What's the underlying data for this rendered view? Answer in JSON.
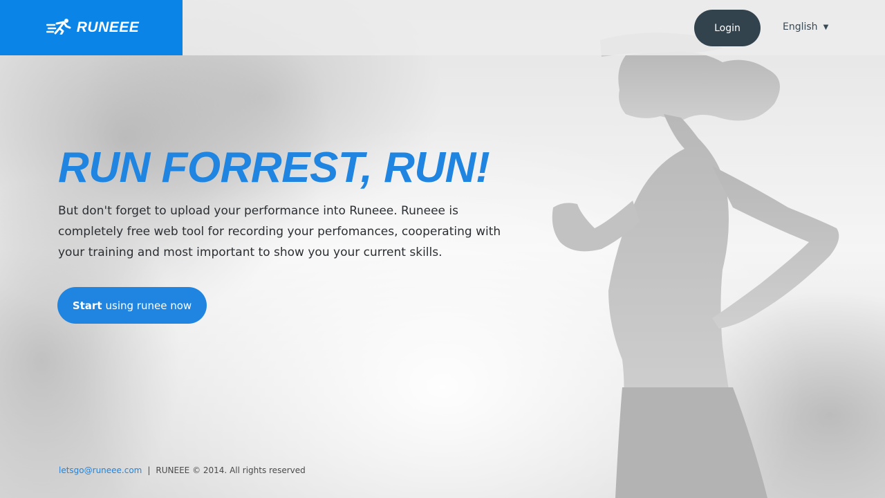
{
  "header": {
    "brand": "RUNEEE",
    "login_label": "Login",
    "language": "English"
  },
  "hero": {
    "headline": "RUN FORREST, RUN!",
    "description": "But don't forget to upload your performance into Runeee. Runeee is completely free web tool for recording your perfomances, cooperating with your training and most important to show you your current skills.",
    "cta_bold": "Start",
    "cta_rest": "using runee now"
  },
  "footer": {
    "email": "letsgo@runeee.com",
    "separator": "|",
    "copyright": "RUNEEE © 2014. All rights reserved"
  },
  "colors": {
    "brand_blue": "#0a84e6",
    "accent_blue": "#1f85e0",
    "login_dark": "#33434d"
  },
  "icons": {
    "logo": "runner-icon",
    "language_caret": "caret-down-icon"
  }
}
